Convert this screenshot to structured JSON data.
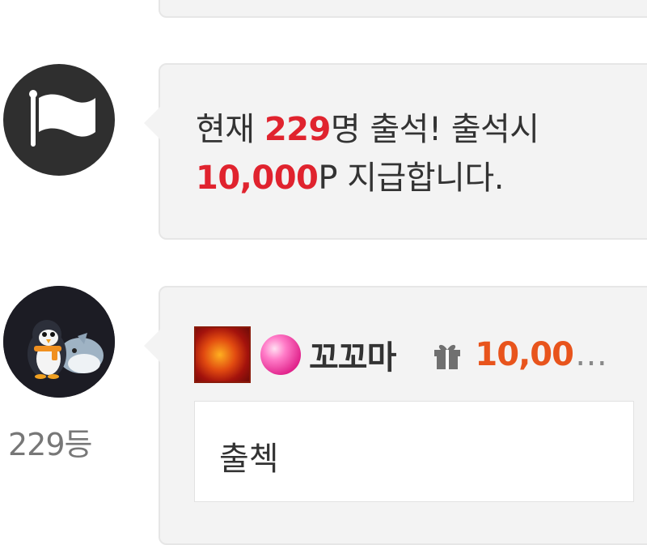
{
  "notice": {
    "text_before_count": "현재 ",
    "count": "229",
    "text_after_count": "명 출석! 출석시",
    "points": "10,000",
    "text_after_points": "P 지급합니다."
  },
  "comment": {
    "rank": "229등",
    "nickname": "꼬꼬마",
    "points": "10,00",
    "ellipsis": "…",
    "content": "출첵"
  },
  "colors": {
    "highlight_red": "#e0232e",
    "points_orange": "#e8541c",
    "bubble_bg": "#f3f3f3",
    "avatar_dark": "#2f2f2f"
  },
  "icons": {
    "notice_avatar": "flag-icon",
    "gift": "gift-icon",
    "level_badge": "dragon-badge-icon",
    "grade_badge": "candy-badge-icon"
  }
}
